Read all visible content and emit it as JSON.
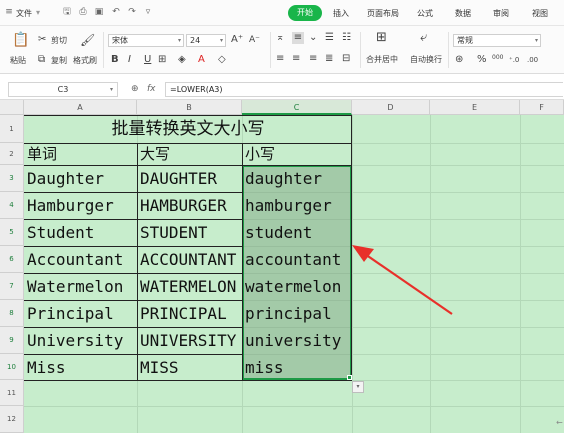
{
  "menu": {
    "file": "文件",
    "tabs": [
      "开始",
      "插入",
      "页面布局",
      "公式",
      "数据",
      "审阅",
      "视图"
    ]
  },
  "toolbar": {
    "paste": "粘贴",
    "cut": "剪切",
    "copy": "复制",
    "format_painter": "格式刷",
    "font_name": "宋体",
    "font_size": "24",
    "bold": "B",
    "italic": "I",
    "underline": "U",
    "merge_center": "合并居中",
    "wrap_text": "自动换行",
    "number_format": "常规",
    "percent": "%",
    "thousands": "000"
  },
  "formula_bar": {
    "cell_ref": "C3",
    "fx": "fx",
    "formula": "=LOWER(A3)"
  },
  "grid": {
    "columns": [
      "A",
      "B",
      "C",
      "D",
      "E",
      "F"
    ],
    "rows": [
      "1",
      "2",
      "3",
      "4",
      "5",
      "6",
      "7",
      "8",
      "9",
      "10",
      "11",
      "12"
    ],
    "title": "批量转换英文大小写",
    "headers": [
      "单词",
      "大写",
      "小写"
    ],
    "data": [
      [
        "Daughter",
        "DAUGHTER",
        "daughter"
      ],
      [
        "Hamburger",
        "HAMBURGER",
        "hamburger"
      ],
      [
        "Student",
        "STUDENT",
        "student"
      ],
      [
        "Accountant",
        "ACCOUNTANT",
        "accountant"
      ],
      [
        "Watermelon",
        "WATERMELON",
        "watermelon"
      ],
      [
        "Principal",
        "PRINCIPAL",
        "principal"
      ],
      [
        "University",
        "UNIVERSITY",
        "university"
      ],
      [
        "Miss",
        "MISS",
        "miss"
      ]
    ]
  },
  "colors": {
    "accent": "#19b54a",
    "sheet_bg": "#c7edcc",
    "arrow": "#e8302a"
  }
}
